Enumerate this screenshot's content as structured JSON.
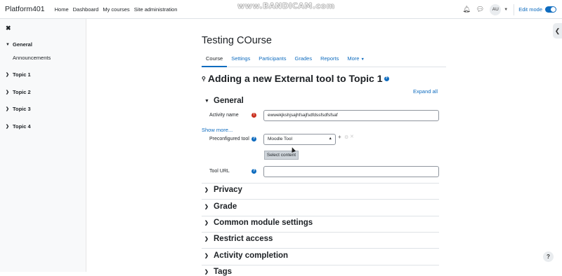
{
  "navbar": {
    "brand": "Platform401",
    "links": [
      "Home",
      "Dashboard",
      "My courses",
      "Site administration"
    ],
    "watermark": "www.BANDICAM.com",
    "avatar_initials": "AU",
    "edit_mode_label": "Edit mode",
    "edit_mode_on": true
  },
  "drawer": {
    "sections": [
      {
        "label": "General",
        "expanded": true,
        "items": [
          "Announcements"
        ]
      },
      {
        "label": "Topic 1",
        "expanded": false
      },
      {
        "label": "Topic 2",
        "expanded": false
      },
      {
        "label": "Topic 3",
        "expanded": false
      },
      {
        "label": "Topic 4",
        "expanded": false
      }
    ]
  },
  "course": {
    "title": "Testing COurse",
    "tabs": [
      "Course",
      "Settings",
      "Participants",
      "Grades",
      "Reports",
      "More"
    ],
    "active_tab": "Course"
  },
  "page": {
    "heading": "Adding a new External tool to Topic 1",
    "expand_all": "Expand all"
  },
  "form": {
    "general_title": "General",
    "activity_name_label": "Activity name",
    "activity_name_value": "ewwekjkshjsajhfsajfsdfdssfsdfsfsaf",
    "show_more": "Show more...",
    "preconfigured_tool_label": "Preconfigured tool",
    "preconfigured_tool_value": "Moodle Tool",
    "select_content_button": "Select content",
    "tool_url_label": "Tool URL",
    "tool_url_value": "",
    "collapsed_sections": [
      "Privacy",
      "Grade",
      "Common module settings",
      "Restrict access",
      "Activity completion",
      "Tags"
    ]
  },
  "colors": {
    "accent": "#0f6cbf",
    "required": "#ca3120"
  }
}
